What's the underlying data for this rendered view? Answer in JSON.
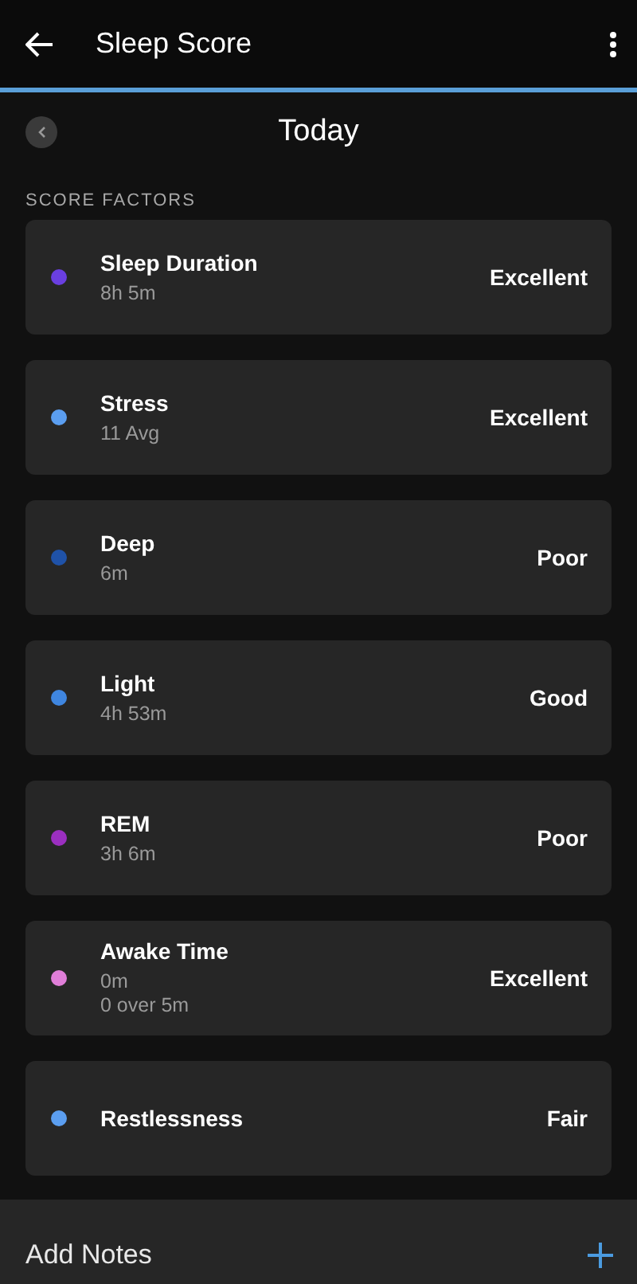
{
  "app_bar": {
    "title": "Sleep Score"
  },
  "date_nav": {
    "label": "Today"
  },
  "section_title": "SCORE FACTORS",
  "factors": [
    {
      "name": "Sleep Duration",
      "details": [
        "8h 5m"
      ],
      "rating": "Excellent",
      "color": "#6a3fe0"
    },
    {
      "name": "Stress",
      "details": [
        "11 Avg"
      ],
      "rating": "Excellent",
      "color": "#5b9ef0"
    },
    {
      "name": "Deep",
      "details": [
        "6m"
      ],
      "rating": "Poor",
      "color": "#1f52a8"
    },
    {
      "name": "Light",
      "details": [
        "4h 53m"
      ],
      "rating": "Good",
      "color": "#3f86e0"
    },
    {
      "name": "REM",
      "details": [
        "3h 6m"
      ],
      "rating": "Poor",
      "color": "#9b2fc0"
    },
    {
      "name": "Awake Time",
      "details": [
        "0m",
        "0 over 5m"
      ],
      "rating": "Excellent",
      "color": "#e07ed8"
    },
    {
      "name": "Restlessness",
      "rating": "Fair",
      "color": "#5b9ef0"
    }
  ],
  "notes_bar": {
    "label": "Add Notes"
  }
}
